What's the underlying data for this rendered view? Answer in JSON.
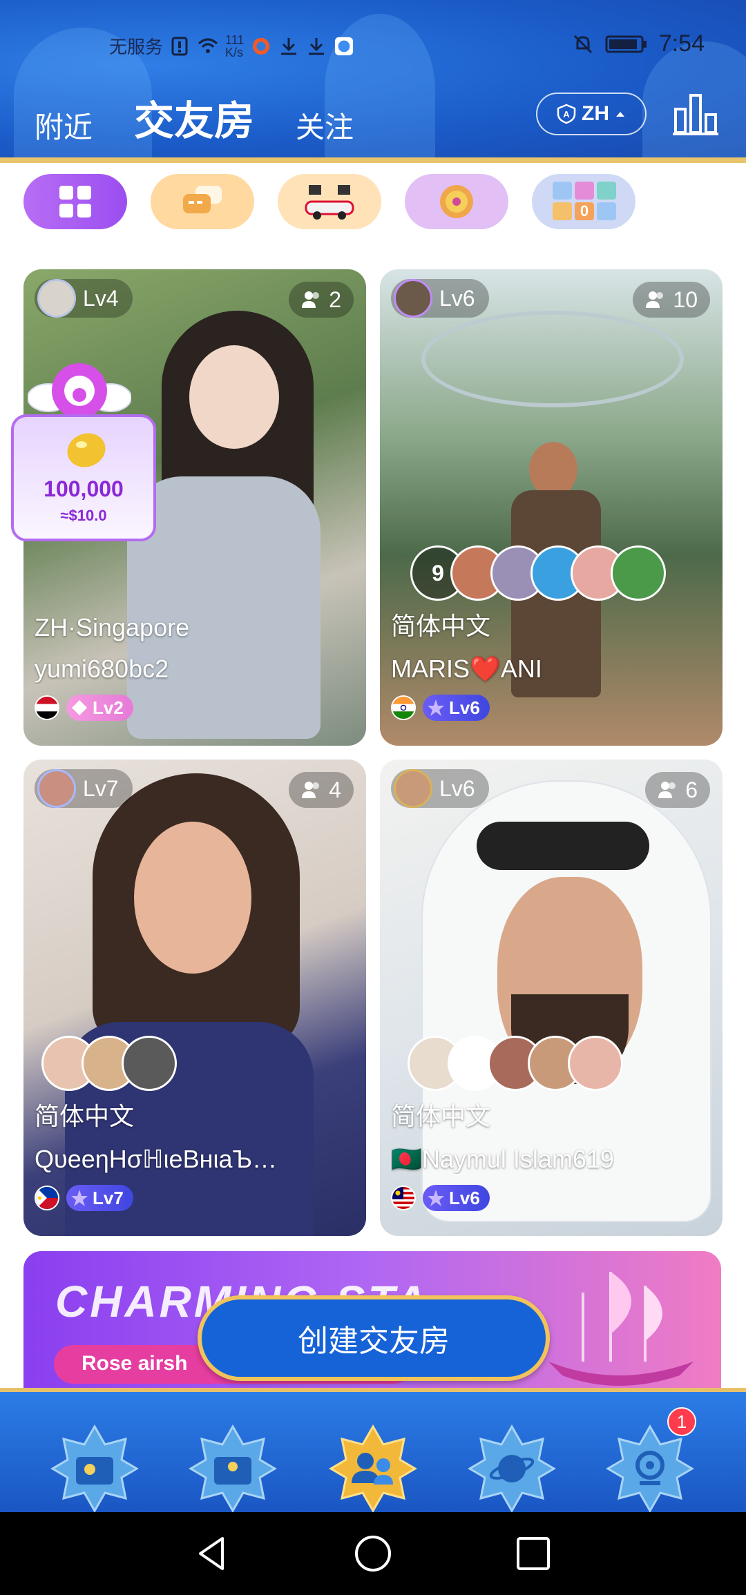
{
  "status_bar": {
    "carrier": "无服务",
    "speed": "111\nK/s",
    "time": "7:54"
  },
  "header": {
    "tabs": [
      {
        "label": "附近",
        "active": false
      },
      {
        "label": "交友房",
        "active": true
      },
      {
        "label": "关注",
        "active": false
      }
    ],
    "lang_button": "ZH",
    "rank_icon": "bar-chart-icon"
  },
  "category_pills": [
    {
      "icon": "grid-icon",
      "color": "#a85bf2"
    },
    {
      "icon": "chat-bubbles-icon",
      "color": "#ffd9a0"
    },
    {
      "icon": "race-car-icon",
      "color": "#ffe2b8"
    },
    {
      "icon": "wheel-icon",
      "color": "#e2c0f5"
    },
    {
      "icon": "number-tiles-icon",
      "color": "#cfd9f5"
    }
  ],
  "rooms": [
    {
      "level": "Lv4",
      "count": "2",
      "lang": "ZH·Singapore",
      "host": "yumi680bc2",
      "badge": "Lv2",
      "flag": "egypt-flag"
    },
    {
      "level": "Lv6",
      "count": "10",
      "lang": "简体中文",
      "host": "MARIS❤️ANI",
      "badge": "Lv6",
      "flag": "india-flag",
      "extra_audience": "9"
    },
    {
      "level": "Lv7",
      "count": "4",
      "lang": "简体中文",
      "host": "QυeeηHσℍιeBнιaЪ…",
      "badge": "Lv7",
      "flag": "philippines-flag"
    },
    {
      "level": "Lv6",
      "count": "6",
      "lang": "简体中文",
      "host": "🇧🇩Naymul Islam619",
      "badge": "Lv6",
      "flag": "malaysia-flag"
    }
  ],
  "reward": {
    "amount": "100,000",
    "usd": "≈$10.0"
  },
  "banner": {
    "title": "CHARMING STA",
    "subtitle": "Rose airsh"
  },
  "create_button": "创建交友房",
  "bottom_nav": {
    "notification_count": "1"
  }
}
